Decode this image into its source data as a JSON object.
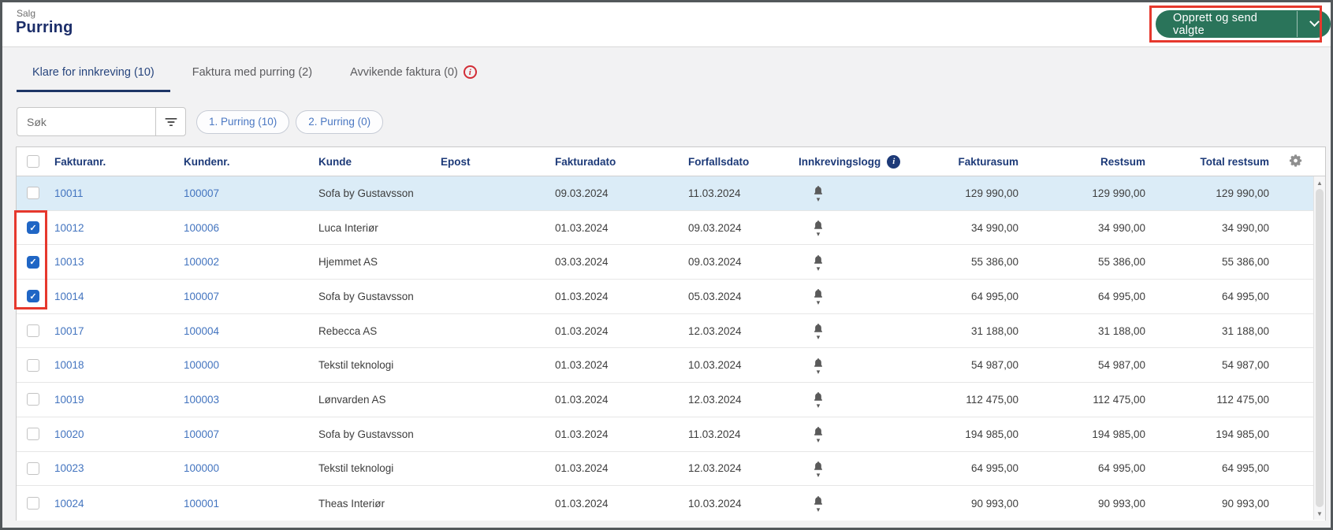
{
  "header": {
    "breadcrumb": "Salg",
    "title": "Purring",
    "action_button": {
      "label": "Opprett og send valgte"
    }
  },
  "tabs": [
    {
      "label": "Klare for innkreving (10)",
      "active": true,
      "alert": false
    },
    {
      "label": "Faktura med purring (2)",
      "active": false,
      "alert": false
    },
    {
      "label": "Avvikende faktura (0)",
      "active": false,
      "alert": true
    }
  ],
  "toolbar": {
    "search_placeholder": "Søk",
    "pills": [
      {
        "label": "1. Purring (10)"
      },
      {
        "label": "2. Purring (0)"
      }
    ]
  },
  "table": {
    "columns": [
      "Fakturanr.",
      "Kundenr.",
      "Kunde",
      "Epost",
      "Fakturadato",
      "Forfallsdato",
      "Innkrevingslogg",
      "Fakturasum",
      "Restsum",
      "Total restsum"
    ],
    "rows": [
      {
        "fakturanr": "10011",
        "kundenr": "100007",
        "kunde": "Sofa by Gustavsson",
        "epost": "",
        "fakturadato": "09.03.2024",
        "forfallsdato": "11.03.2024",
        "fakturasum": "129 990,00",
        "restsum": "129 990,00",
        "total_restsum": "129 990,00",
        "checked": false,
        "highlighted": true
      },
      {
        "fakturanr": "10012",
        "kundenr": "100006",
        "kunde": "Luca Interiør",
        "epost": "",
        "fakturadato": "01.03.2024",
        "forfallsdato": "09.03.2024",
        "fakturasum": "34 990,00",
        "restsum": "34 990,00",
        "total_restsum": "34 990,00",
        "checked": true,
        "highlighted": false
      },
      {
        "fakturanr": "10013",
        "kundenr": "100002",
        "kunde": "Hjemmet AS",
        "epost": "",
        "fakturadato": "03.03.2024",
        "forfallsdato": "09.03.2024",
        "fakturasum": "55 386,00",
        "restsum": "55 386,00",
        "total_restsum": "55 386,00",
        "checked": true,
        "highlighted": false
      },
      {
        "fakturanr": "10014",
        "kundenr": "100007",
        "kunde": "Sofa by Gustavsson",
        "epost": "",
        "fakturadato": "01.03.2024",
        "forfallsdato": "05.03.2024",
        "fakturasum": "64 995,00",
        "restsum": "64 995,00",
        "total_restsum": "64 995,00",
        "checked": true,
        "highlighted": false
      },
      {
        "fakturanr": "10017",
        "kundenr": "100004",
        "kunde": "Rebecca AS",
        "epost": "",
        "fakturadato": "01.03.2024",
        "forfallsdato": "12.03.2024",
        "fakturasum": "31 188,00",
        "restsum": "31 188,00",
        "total_restsum": "31 188,00",
        "checked": false,
        "highlighted": false
      },
      {
        "fakturanr": "10018",
        "kundenr": "100000",
        "kunde": "Tekstil teknologi",
        "epost": "",
        "fakturadato": "01.03.2024",
        "forfallsdato": "10.03.2024",
        "fakturasum": "54 987,00",
        "restsum": "54 987,00",
        "total_restsum": "54 987,00",
        "checked": false,
        "highlighted": false
      },
      {
        "fakturanr": "10019",
        "kundenr": "100003",
        "kunde": "Lønvarden AS",
        "epost": "",
        "fakturadato": "01.03.2024",
        "forfallsdato": "12.03.2024",
        "fakturasum": "112 475,00",
        "restsum": "112 475,00",
        "total_restsum": "112 475,00",
        "checked": false,
        "highlighted": false
      },
      {
        "fakturanr": "10020",
        "kundenr": "100007",
        "kunde": "Sofa by Gustavsson",
        "epost": "",
        "fakturadato": "01.03.2024",
        "forfallsdato": "11.03.2024",
        "fakturasum": "194 985,00",
        "restsum": "194 985,00",
        "total_restsum": "194 985,00",
        "checked": false,
        "highlighted": false
      },
      {
        "fakturanr": "10023",
        "kundenr": "100000",
        "kunde": "Tekstil teknologi",
        "epost": "",
        "fakturadato": "01.03.2024",
        "forfallsdato": "12.03.2024",
        "fakturasum": "64 995,00",
        "restsum": "64 995,00",
        "total_restsum": "64 995,00",
        "checked": false,
        "highlighted": false
      },
      {
        "fakturanr": "10024",
        "kundenr": "100001",
        "kunde": "Theas Interiør",
        "epost": "",
        "fakturadato": "01.03.2024",
        "forfallsdato": "10.03.2024",
        "fakturasum": "90 993,00",
        "restsum": "90 993,00",
        "total_restsum": "90 993,00",
        "checked": false,
        "highlighted": false
      }
    ]
  },
  "icons": {
    "filter": "filter-lines",
    "settings": "gear",
    "collection_log": "bell-with-caret",
    "column_info": "info-circle-navy",
    "tab_alert": "info-circle-red",
    "button_caret": "chevron-down",
    "scroll_up": "triangle-up",
    "scroll_down": "triangle-down"
  },
  "colors": {
    "accent_green": "#2a745a",
    "annotation_red": "#e6382d",
    "link_blue": "#4374bf",
    "navy_header": "#1d3a78",
    "row_highlight": "#dbecf7",
    "checkbox_checked": "#2066c5"
  }
}
